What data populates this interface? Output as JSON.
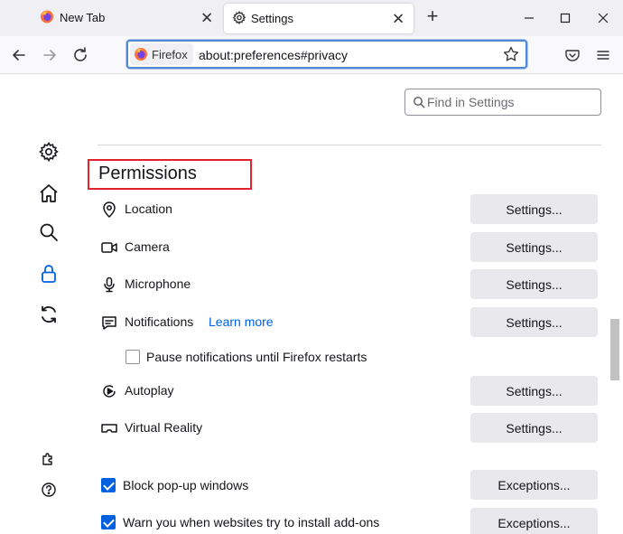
{
  "tabs": [
    {
      "label": "New Tab",
      "active": false
    },
    {
      "label": "Settings",
      "active": true
    }
  ],
  "window_controls": {
    "minimize": "–",
    "maximize": "□",
    "close": "✕"
  },
  "toolbar": {
    "identity_label": "Firefox",
    "url": "about:preferences#privacy",
    "icons": [
      "back-icon",
      "forward-icon",
      "reload-icon",
      "bookmark-star-icon",
      "pocket-icon",
      "menu-icon"
    ]
  },
  "sidebar": {
    "items": [
      {
        "name": "general",
        "icon": "gear-icon"
      },
      {
        "name": "home",
        "icon": "home-icon"
      },
      {
        "name": "search",
        "icon": "search-icon"
      },
      {
        "name": "privacy",
        "icon": "lock-icon",
        "active": true
      },
      {
        "name": "sync",
        "icon": "sync-icon"
      }
    ],
    "footer": [
      {
        "name": "extensions",
        "icon": "puzzle-icon"
      },
      {
        "name": "support",
        "icon": "help-icon"
      }
    ]
  },
  "search": {
    "placeholder": "Find in Settings",
    "value": ""
  },
  "section": {
    "heading": "Permissions"
  },
  "permissions": [
    {
      "label": "Location",
      "icon": "location-icon",
      "button": "Settings..."
    },
    {
      "label": "Camera",
      "icon": "camera-icon",
      "button": "Settings..."
    },
    {
      "label": "Microphone",
      "icon": "microphone-icon",
      "button": "Settings..."
    },
    {
      "label": "Notifications",
      "icon": "notification-icon",
      "button": "Settings...",
      "link": "Learn more"
    },
    {
      "label": "Autoplay",
      "icon": "autoplay-icon",
      "button": "Settings..."
    },
    {
      "label": "Virtual Reality",
      "icon": "vr-icon",
      "button": "Settings..."
    }
  ],
  "pause_notifications": {
    "label": "Pause notifications until Firefox restarts",
    "checked": false
  },
  "block_popups": {
    "label": "Block pop-up windows",
    "checked": true,
    "button": "Exceptions..."
  },
  "warn_addons": {
    "label": "Warn you when websites try to install add-ons",
    "checked": true,
    "button": "Exceptions..."
  },
  "colors": {
    "accent": "#0061e0",
    "highlight_box": "#e0232c",
    "button_bg": "#e9e9ed",
    "tab_bg": "#f0f0f4"
  }
}
